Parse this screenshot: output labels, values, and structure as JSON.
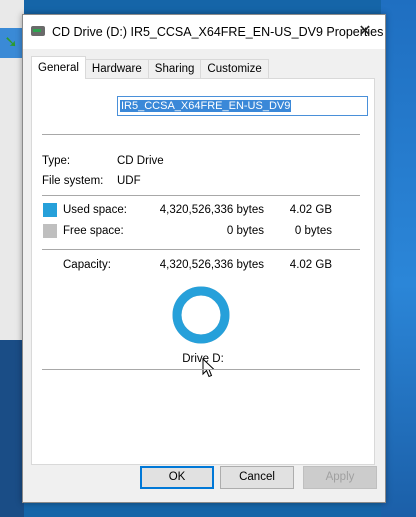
{
  "window": {
    "title": "CD Drive (D:) IR5_CCSA_X64FRE_EN-US_DV9 Properties",
    "close_label": "✕"
  },
  "tabs": [
    {
      "label": "General",
      "active": true
    },
    {
      "label": "Hardware"
    },
    {
      "label": "Sharing"
    },
    {
      "label": "Customize"
    }
  ],
  "general": {
    "volume_name": "IR5_CCSA_X64FRE_EN-US_DV9",
    "type_label": "Type:",
    "type_value": "CD Drive",
    "fs_label": "File system:",
    "fs_value": "UDF",
    "used": {
      "label": "Used space:",
      "bytes": "4,320,526,336 bytes",
      "size": "4.02 GB",
      "color": "#26a0da"
    },
    "free": {
      "label": "Free space:",
      "bytes": "0 bytes",
      "size": "0 bytes",
      "color": "#bfbfbf"
    },
    "capacity": {
      "label": "Capacity:",
      "bytes": "4,320,526,336 bytes",
      "size": "4.02 GB"
    },
    "drive_label": "Drive D:",
    "used_fraction": 1.0
  },
  "buttons": {
    "ok": "OK",
    "cancel": "Cancel",
    "apply": "Apply"
  }
}
